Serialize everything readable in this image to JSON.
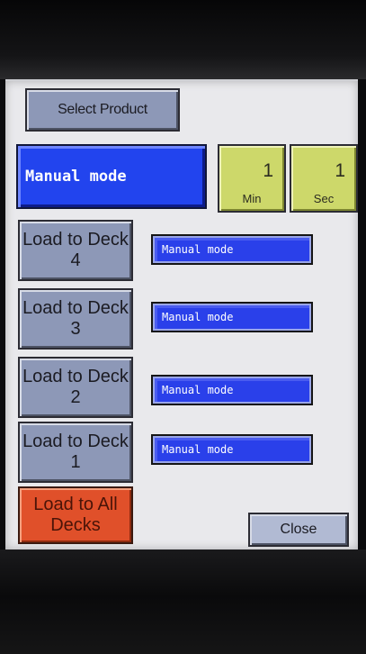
{
  "toolbar": {
    "select_product_label": "Select Product"
  },
  "status": {
    "mode_display": "Manual mode"
  },
  "timer": {
    "minutes_value": "1",
    "minutes_unit": "Min",
    "seconds_value": "1",
    "seconds_unit": "Sec"
  },
  "decks": [
    {
      "button_label": "Load to Deck 4",
      "mode": "Manual mode"
    },
    {
      "button_label": "Load to Deck 3",
      "mode": "Manual mode"
    },
    {
      "button_label": "Load to Deck 2",
      "mode": "Manual mode"
    },
    {
      "button_label": "Load to Deck 1",
      "mode": "Manual mode"
    }
  ],
  "actions": {
    "load_all_label": "Load to All Decks",
    "close_label": "Close"
  },
  "colors": {
    "mode_blue": "#2244ee",
    "timer_yellow": "#cdd86a",
    "button_slate": "#8d98b7",
    "load_all_orange": "#e0502a",
    "screen_bg": "#e9e9ec"
  }
}
